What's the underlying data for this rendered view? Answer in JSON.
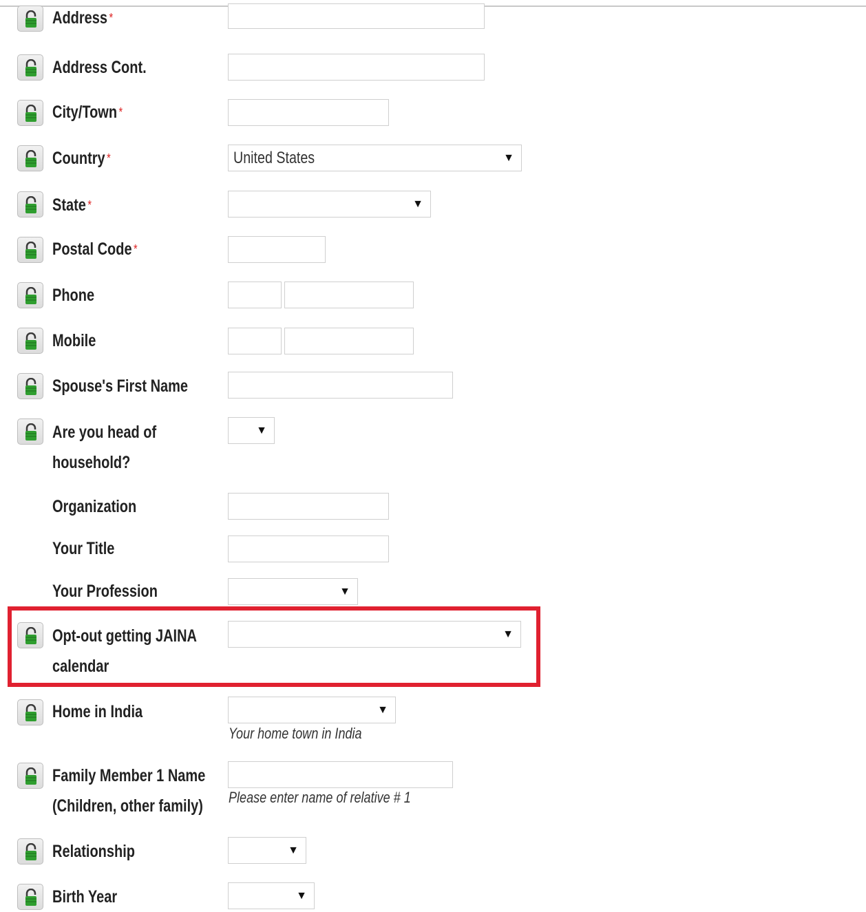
{
  "required_mark": "*",
  "fields": {
    "address": {
      "label": "Address",
      "value": ""
    },
    "address_cont": {
      "label": "Address Cont.",
      "value": ""
    },
    "city": {
      "label": "City/Town",
      "value": ""
    },
    "country": {
      "label": "Country",
      "value": "United States"
    },
    "state": {
      "label": "State",
      "value": ""
    },
    "postal_code": {
      "label": "Postal Code",
      "value": ""
    },
    "phone": {
      "label": "Phone",
      "area": "",
      "number": ""
    },
    "mobile": {
      "label": "Mobile",
      "area": "",
      "number": ""
    },
    "spouse": {
      "label": "Spouse's First Name",
      "value": ""
    },
    "head_household": {
      "label_line1": "Are you head of",
      "label_line2": "household?",
      "value": ""
    },
    "organization": {
      "label": "Organization",
      "value": ""
    },
    "title": {
      "label": "Your Title",
      "value": ""
    },
    "profession": {
      "label": "Your Profession",
      "value": ""
    },
    "jaina_optout": {
      "label_line1": "Opt-out getting JAINA",
      "label_line2": "calendar",
      "value": ""
    },
    "home_india": {
      "label": "Home in India",
      "value": "",
      "help": "Your home town in India"
    },
    "family1": {
      "label_line1": "Family Member 1 Name",
      "label_line2": "(Children, other family)",
      "value": "",
      "help": "Please enter name of relative # 1"
    },
    "relationship": {
      "label": "Relationship",
      "value": ""
    },
    "birth_year": {
      "label": "Birth Year",
      "value": ""
    }
  },
  "icons": {
    "privacy": "unlocked-padlock-icon",
    "dropdown": "dropdown-arrow-icon"
  },
  "colors": {
    "required": "#dd2222",
    "highlight": "#e02130",
    "lock_body": "#2f9e2f"
  }
}
